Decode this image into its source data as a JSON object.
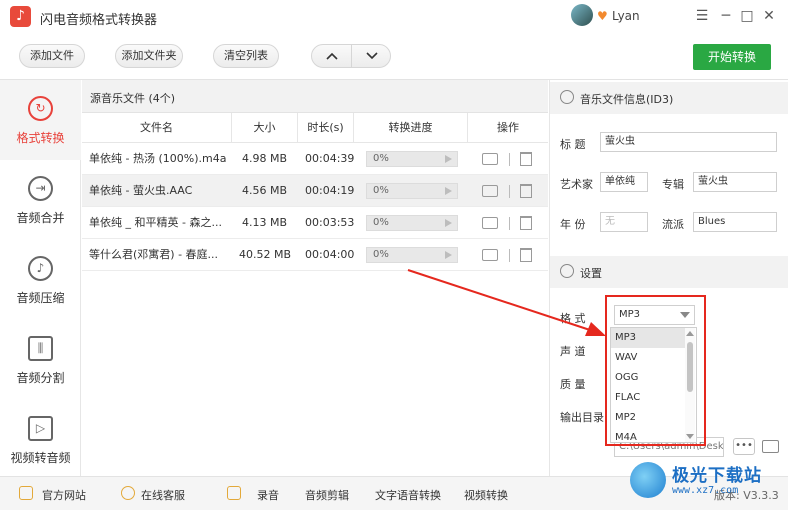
{
  "app": {
    "title": "闪电音频格式转换器",
    "logo_glyph": "♪",
    "user": "Lyan",
    "vip_glyph": "♥",
    "avatar_color": "#4a7a8a"
  },
  "window": {
    "minimize": "─",
    "restore": "☐",
    "maximize": "□",
    "close": "✕"
  },
  "toolbar": {
    "add_file": "添加文件",
    "add_folder": "添加文件夹",
    "clear_list": "清空列表",
    "move_up": "⌃",
    "move_down": "⌄",
    "start": "开始转换",
    "start_color": "#2aa843"
  },
  "sidebar": {
    "items": [
      {
        "label": "格式转换",
        "icon": "refresh-icon",
        "glyph": "↻",
        "active": true
      },
      {
        "label": "音频合并",
        "icon": "merge-icon",
        "glyph": "⇥"
      },
      {
        "label": "音频压缩",
        "icon": "compress-icon",
        "glyph": "♪"
      },
      {
        "label": "音频分割",
        "icon": "split-icon",
        "glyph": "⫼"
      },
      {
        "label": "视频转音频",
        "icon": "video-icon",
        "glyph": "▷"
      }
    ]
  },
  "file_panel": {
    "header": "源音乐文件 (4个)",
    "columns": [
      "文件名",
      "大小",
      "时长(s)",
      "转换进度",
      "操作"
    ],
    "rows": [
      {
        "name": "单依纯 - 热汤 (100%).m4a",
        "size": "4.98 MB",
        "duration": "00:04:39",
        "progress": "0%"
      },
      {
        "name": "单依纯 - 萤火虫.AAC",
        "size": "4.56 MB",
        "duration": "00:04:19",
        "progress": "0%"
      },
      {
        "name": "单依纯 _ 和平精英 - 森之...",
        "size": "4.13 MB",
        "duration": "00:03:53",
        "progress": "0%"
      },
      {
        "name": "等什么君(邓寓君) - 春庭...",
        "size": "40.52 MB",
        "duration": "00:04:00",
        "progress": "0%"
      }
    ],
    "selected_row": 1
  },
  "info": {
    "header": "音乐文件信息(ID3)",
    "title_label": "标  题",
    "title_value": "萤火虫",
    "artist_label": "艺术家",
    "artist_value": "单依纯",
    "album_label": "专辑",
    "album_value": "萤火虫",
    "year_label": "年  份",
    "year_placeholder": "无",
    "genre_label": "流派",
    "genre_value": "Blues"
  },
  "settings": {
    "header": "设置",
    "format_label": "格  式",
    "format_value": "MP3",
    "channel_label": "声  道",
    "quality_label": "质  量",
    "output_label": "输出目录",
    "output_value": "C:\\Users\\admin\\Desktc",
    "more_button": "•••",
    "format_options": [
      "MP3",
      "WAV",
      "OGG",
      "FLAC",
      "MP2",
      "M4A"
    ],
    "highlighted_option": "MP3",
    "highlight_color": "#e5281e"
  },
  "footer": {
    "items": [
      "官方网站",
      "在线客服",
      "录音",
      "音频剪辑",
      "文字语音转换",
      "视频转换"
    ],
    "version": "版本: V3.3.3"
  },
  "watermark": {
    "text": "极光下载站",
    "sub": "www.xz7.com"
  }
}
